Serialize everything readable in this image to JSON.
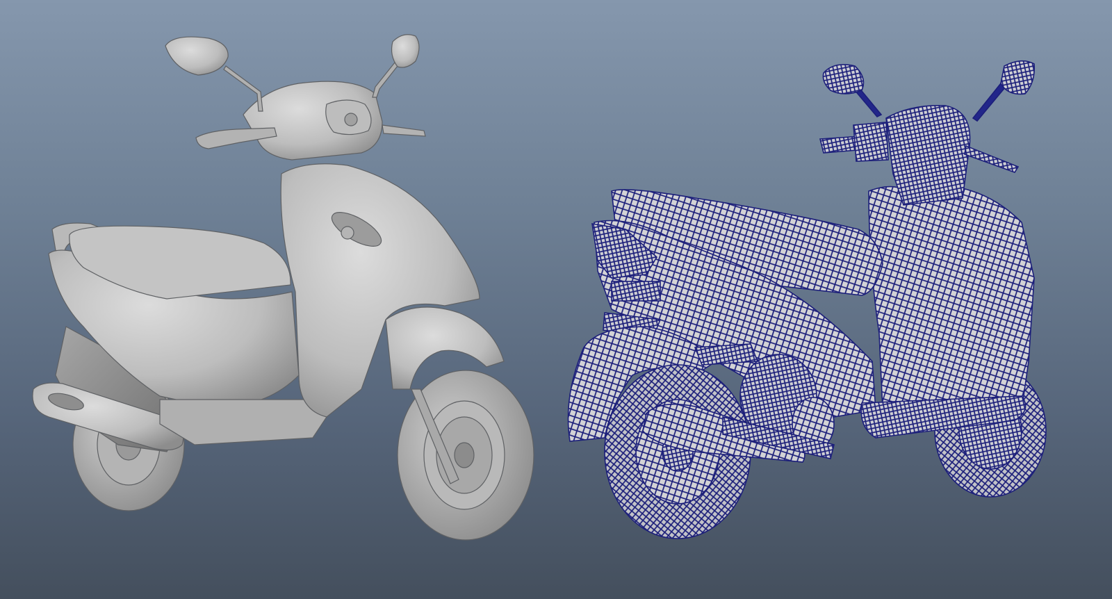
{
  "scene": {
    "background_top": "#8597ad",
    "background_bottom": "#444f5d"
  },
  "models": [
    {
      "id": "shaded",
      "shading": "smooth-shaded",
      "color": "#c9c9c9"
    },
    {
      "id": "wireframe",
      "shading": "wireframe-on-shaded",
      "color": "#d6d6d9",
      "wire_color": "#1c1f7a"
    }
  ]
}
